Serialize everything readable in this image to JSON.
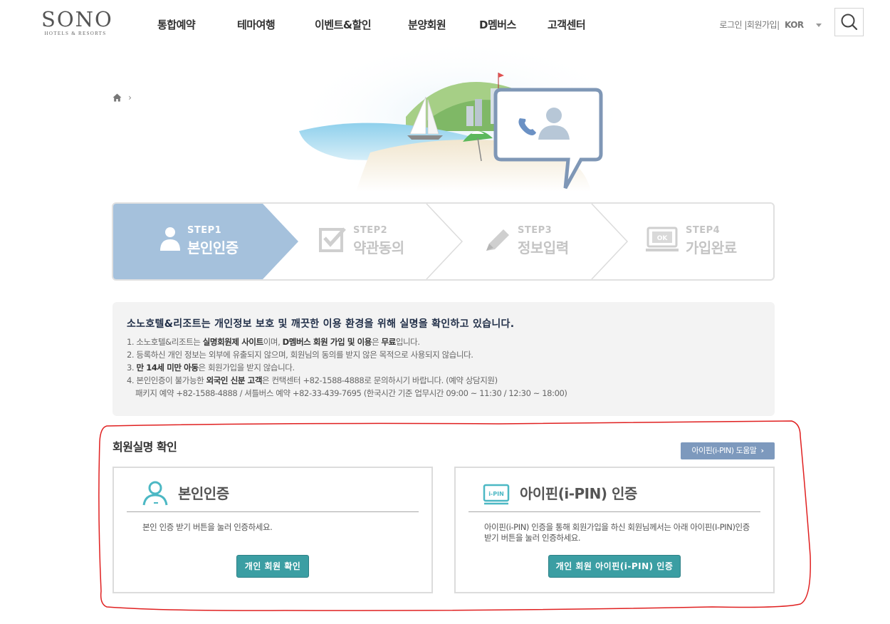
{
  "header": {
    "logo_main": "SONO",
    "logo_sub": "HOTELS & RESORTS",
    "nav": [
      "통합예약",
      "테마여행",
      "이벤트&할인",
      "분양회원",
      "D멤버스",
      "고객센터"
    ],
    "util": {
      "login": "로그인",
      "signup": "회원가입",
      "lang": "KOR"
    }
  },
  "steps": [
    {
      "no": "STEP1",
      "name": "본인인증",
      "active": true
    },
    {
      "no": "STEP2",
      "name": "약관동의",
      "active": false
    },
    {
      "no": "STEP3",
      "name": "정보입력",
      "active": false
    },
    {
      "no": "STEP4",
      "name": "가입완료",
      "active": false
    }
  ],
  "notice": {
    "title": "소노호텔&리조트는 개인정보 보호 및 깨끗한 이용 환경을 위해 실명을 확인하고 있습니다.",
    "line1": {
      "a": "1. 소노호텔&리조트는 ",
      "b": "실명회원제 사이트",
      "c": "이며, ",
      "d": "D멤버스 회원 가입 및 이용",
      "e": "은 ",
      "f": "무료",
      "g": "입니다."
    },
    "line2": "2. 등록하신 개인 정보는 외부에 유출되지 않으며, 회원님의 동의를 받지 않은 목적으로 사용되지 않습니다.",
    "line3": {
      "a": "3. ",
      "b": "만 14세 미만 아동",
      "c": "은 회원가입을 받지 않습니다."
    },
    "line4": {
      "a": "4. 본인인증이 불가능한 ",
      "b": "외국인 신분 고객",
      "c": "은 컨택센터 +82-1588-4888로 문의하시기 바랍니다. (예약 상담지원)"
    },
    "line5": "패키지 예약 +82-1588-4888 / 셔틀버스 예약 +82-33-439-7695 (한국시간 기준 업무시간 09:00 ~ 11:30 / 12:30 ~ 18:00)"
  },
  "verify": {
    "section_title": "회원실명 확인",
    "help_label": "아이핀(i-PIN) 도움말",
    "self": {
      "title": "본인인증",
      "desc": "본인 인증 받기 버튼을 눌러 인증하세요.",
      "button": "개인 회원 확인"
    },
    "ipin": {
      "icon_text": "i-PIN",
      "title": "아이핀(i-PIN) 인증",
      "desc": "아이핀(i-PIN) 인증을 통해 회원가입을 하신 회원님께서는 아래 아이핀(I-PIN)인증 받기 버튼을 눌러 인증하세요.",
      "button": "개인 회원 아이핀(i-PIN) 인증"
    }
  },
  "colors": {
    "step_active": "#a5c1dc",
    "button_teal": "#3b9ea3",
    "help_button": "#7d99bd",
    "annotation_red": "#e02020"
  }
}
